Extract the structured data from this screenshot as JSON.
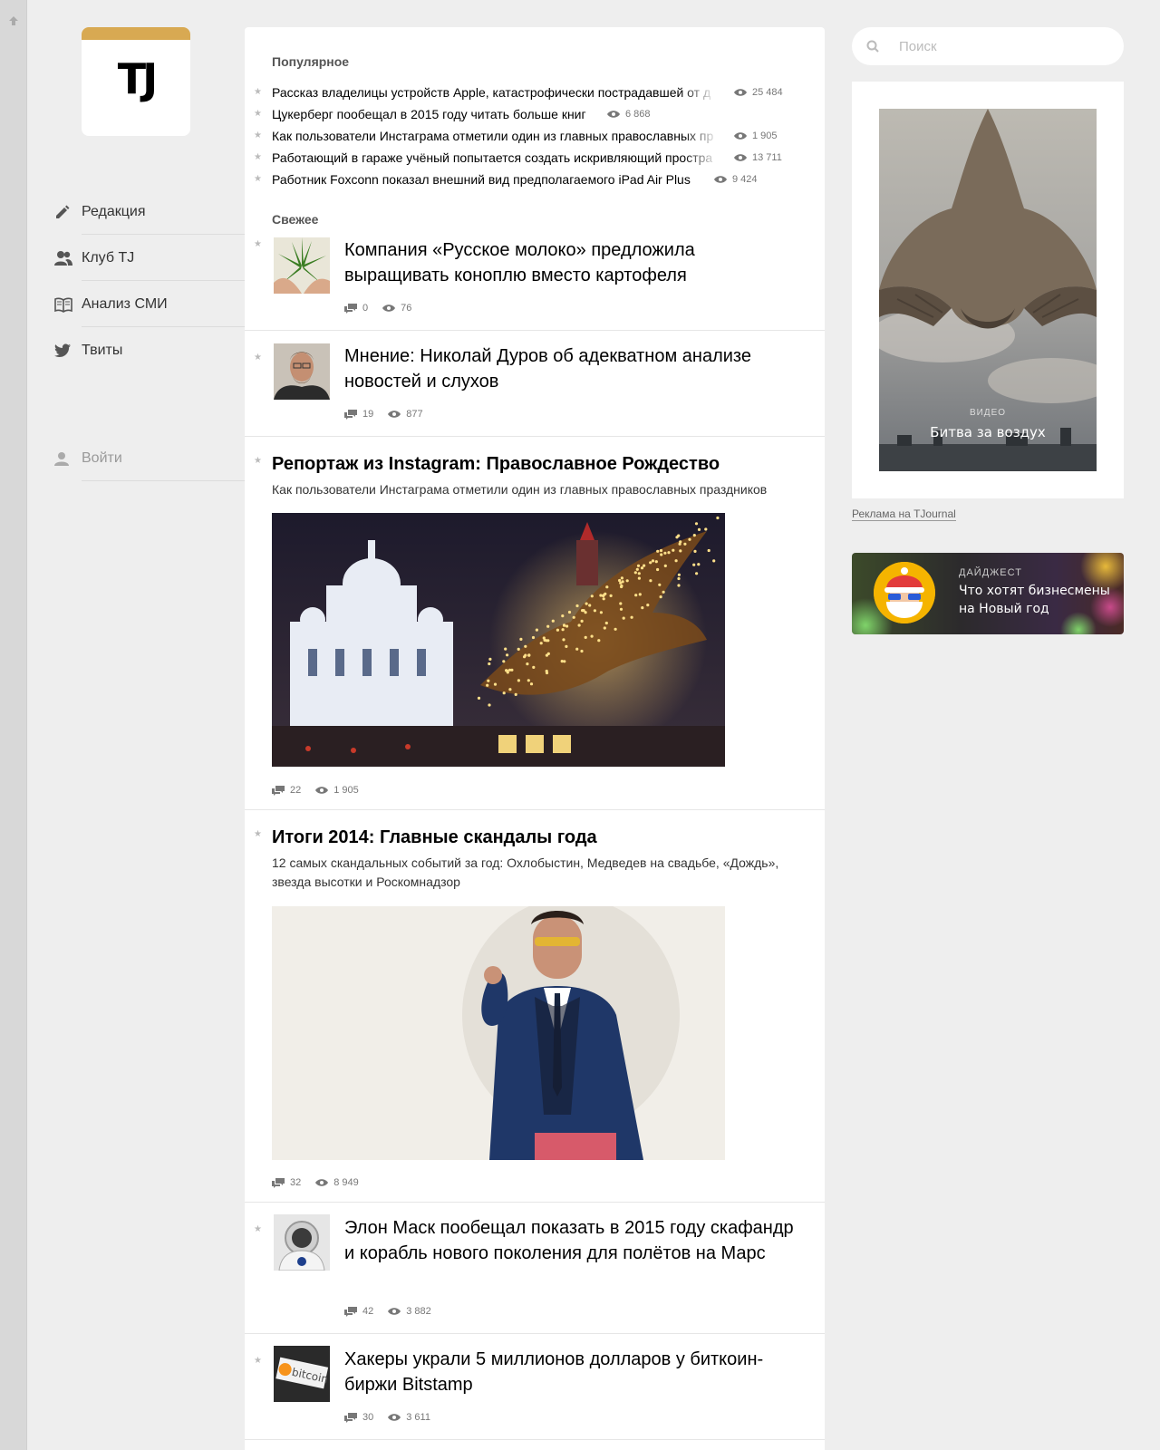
{
  "sidebar": {
    "logo_text": "TJ",
    "items": [
      {
        "label": "Редакция",
        "icon": "pencil-icon"
      },
      {
        "label": "Клуб TJ",
        "icon": "users-icon"
      },
      {
        "label": "Анализ СМИ",
        "icon": "book-icon"
      },
      {
        "label": "Твиты",
        "icon": "twitter-icon"
      }
    ],
    "login_label": "Войти"
  },
  "popular": {
    "title": "Популярное",
    "items": [
      {
        "title": "Рассказ владелицы устройств Apple, катастрофически пострадавшей от д",
        "views": "25 484"
      },
      {
        "title": "Цукерберг пообещал в 2015 году читать больше книг",
        "views": "6 868"
      },
      {
        "title": "Как пользователи Инстаграма отметили один из главных православных пр",
        "views": "1 905"
      },
      {
        "title": "Работающий в гараже учёный попытается создать искривляющий простра",
        "views": "13 711"
      },
      {
        "title": "Работник Foxconn показал внешний вид предполагаемого iPad Air Plus",
        "views": "9 424"
      }
    ]
  },
  "fresh": {
    "title": "Свежее",
    "entries": [
      {
        "title": "Компания «Русское молоко» предложила выращивать коноплю вместо картофеля",
        "comments": "0",
        "views": "76"
      },
      {
        "title": "Мнение: Николай Дуров об адекватном анализе новостей и слухов",
        "comments": "19",
        "views": "877"
      },
      {
        "title": "Репортаж из Instagram: Православное Рождество",
        "lead": "Как пользователи Инстаграма отметили один из главных православных праздников",
        "comments": "22",
        "views": "1 905"
      },
      {
        "title": "Итоги 2014: Главные скандалы года",
        "lead": "12 самых скандальных событий за год: Охлобыстин, Медведев на свадьбе, «Дождь», звезда высотки и Роскомнадзор",
        "comments": "32",
        "views": "8 949"
      },
      {
        "title": "Элон Маск пообещал показать в 2015 году скафандр и корабль нового поколения для полётов на Марс",
        "comments": "42",
        "views": "3 882"
      },
      {
        "title": "Хакеры украли 5 миллионов долларов у биткоин-биржи Bitstamp",
        "comments": "30",
        "views": "3 611"
      }
    ]
  },
  "search": {
    "placeholder": "Поиск"
  },
  "ad": {
    "kicker": "ВИДЕО",
    "headline": "Битва за воздух",
    "link": "Реклама на TJournal"
  },
  "digest": {
    "kicker": "ДАЙДЖЕСТ",
    "title": "Что хотят бизнесмены на Новый год"
  },
  "colors": {
    "accent": "#d8a952",
    "background": "#eeeeee"
  }
}
